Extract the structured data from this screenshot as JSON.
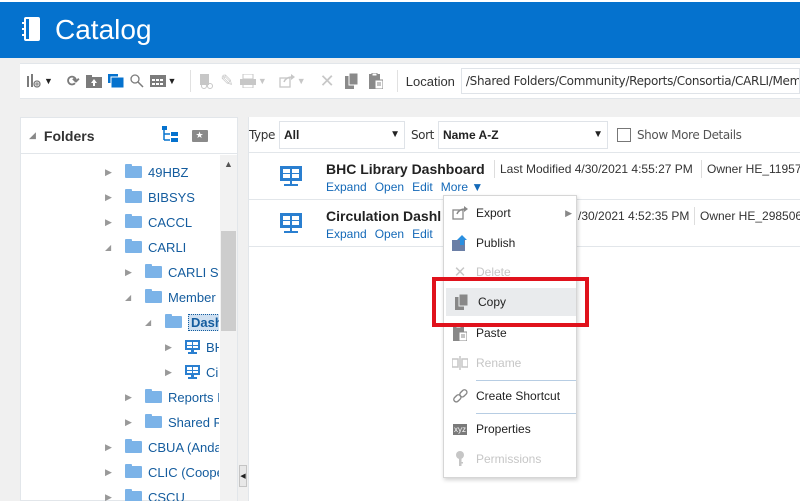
{
  "header": {
    "title": "Catalog",
    "icon": "catalog-book-icon"
  },
  "toolbar": {
    "icons": [
      "new-dropdown-icon",
      "refresh-icon",
      "upload-icon",
      "folder-open-icon",
      "search-icon",
      "view-dropdown-icon",
      "copy-link-icon",
      "edit-icon",
      "print-dropdown-icon",
      "export-dropdown-icon",
      "delete-icon",
      "copy-icon",
      "paste-icon"
    ],
    "location_label": "Location",
    "location_value": "/Shared Folders/Community/Reports/Consortia/CARLI/Member Libraries/Dashboards"
  },
  "folders": {
    "title": "Folders",
    "tree": [
      {
        "label": "49HBZ",
        "level": 0,
        "state": "collapsed",
        "type": "folder"
      },
      {
        "label": "BIBSYS",
        "level": 0,
        "state": "collapsed",
        "type": "folder"
      },
      {
        "label": "CACCL",
        "level": 0,
        "state": "collapsed",
        "type": "folder"
      },
      {
        "label": "CARLI",
        "level": 0,
        "state": "expanded",
        "type": "folder"
      },
      {
        "label": "CARLI Sta",
        "level": 1,
        "state": "collapsed",
        "type": "folder"
      },
      {
        "label": "Member L",
        "level": 1,
        "state": "expanded",
        "type": "folder"
      },
      {
        "label": "Dashb",
        "level": 2,
        "state": "expanded",
        "type": "folder",
        "selected": true
      },
      {
        "label": "BH",
        "level": 3,
        "state": "collapsed",
        "type": "dashboard"
      },
      {
        "label": "Cir",
        "level": 3,
        "state": "collapsed",
        "type": "dashboard"
      },
      {
        "label": "Reports I",
        "level": 1,
        "state": "collapsed",
        "type": "folder"
      },
      {
        "label": "Shared R",
        "level": 1,
        "state": "collapsed",
        "type": "folder"
      },
      {
        "label": "CBUA (Andal",
        "level": 0,
        "state": "collapsed",
        "type": "folder"
      },
      {
        "label": "CLIC (Coope",
        "level": 0,
        "state": "collapsed",
        "type": "folder"
      },
      {
        "label": "CSCU",
        "level": 0,
        "state": "collapsed",
        "type": "folder"
      }
    ]
  },
  "filter": {
    "type_label": "Type",
    "type_value": "All",
    "sort_label": "Sort",
    "sort_value": "Name A-Z",
    "show_more_details": "Show More Details",
    "show_more_checked": false
  },
  "items": [
    {
      "name": "BHC Library Dashboard",
      "last_modified": "Last Modified 4/30/2021 4:55:27 PM",
      "owner": "Owner HE_11957",
      "links": [
        "Expand",
        "Open",
        "Edit",
        "More ▼"
      ]
    },
    {
      "name": "Circulation Dashl",
      "last_modified": "/30/2021 4:52:35 PM",
      "owner": "Owner HE_298506",
      "links": [
        "Expand",
        "Open",
        "Edit"
      ]
    }
  ],
  "context_menu": {
    "items": [
      {
        "label": "Export",
        "icon": "export-icon",
        "disabled": false,
        "submenu": true
      },
      {
        "label": "Publish",
        "icon": "publish-icon",
        "disabled": false
      },
      {
        "label": "Delete",
        "icon": "delete-icon",
        "disabled": true
      },
      {
        "label": "Copy",
        "icon": "copy-icon",
        "disabled": false,
        "highlighted": true
      },
      {
        "label": "Paste",
        "icon": "paste-icon",
        "disabled": false
      },
      {
        "label": "Rename",
        "icon": "rename-icon",
        "disabled": true
      },
      {
        "label": "Create Shortcut",
        "icon": "link-icon",
        "disabled": false
      },
      {
        "label": "Properties",
        "icon": "properties-xyz-icon",
        "disabled": false,
        "icon_text": "xyz"
      },
      {
        "label": "Permissions",
        "icon": "key-icon",
        "disabled": true
      }
    ]
  },
  "colors": {
    "brand": "#0572ce",
    "highlight_box": "#e0121c",
    "link": "#1469b8",
    "folder": "#7bb3e8"
  }
}
